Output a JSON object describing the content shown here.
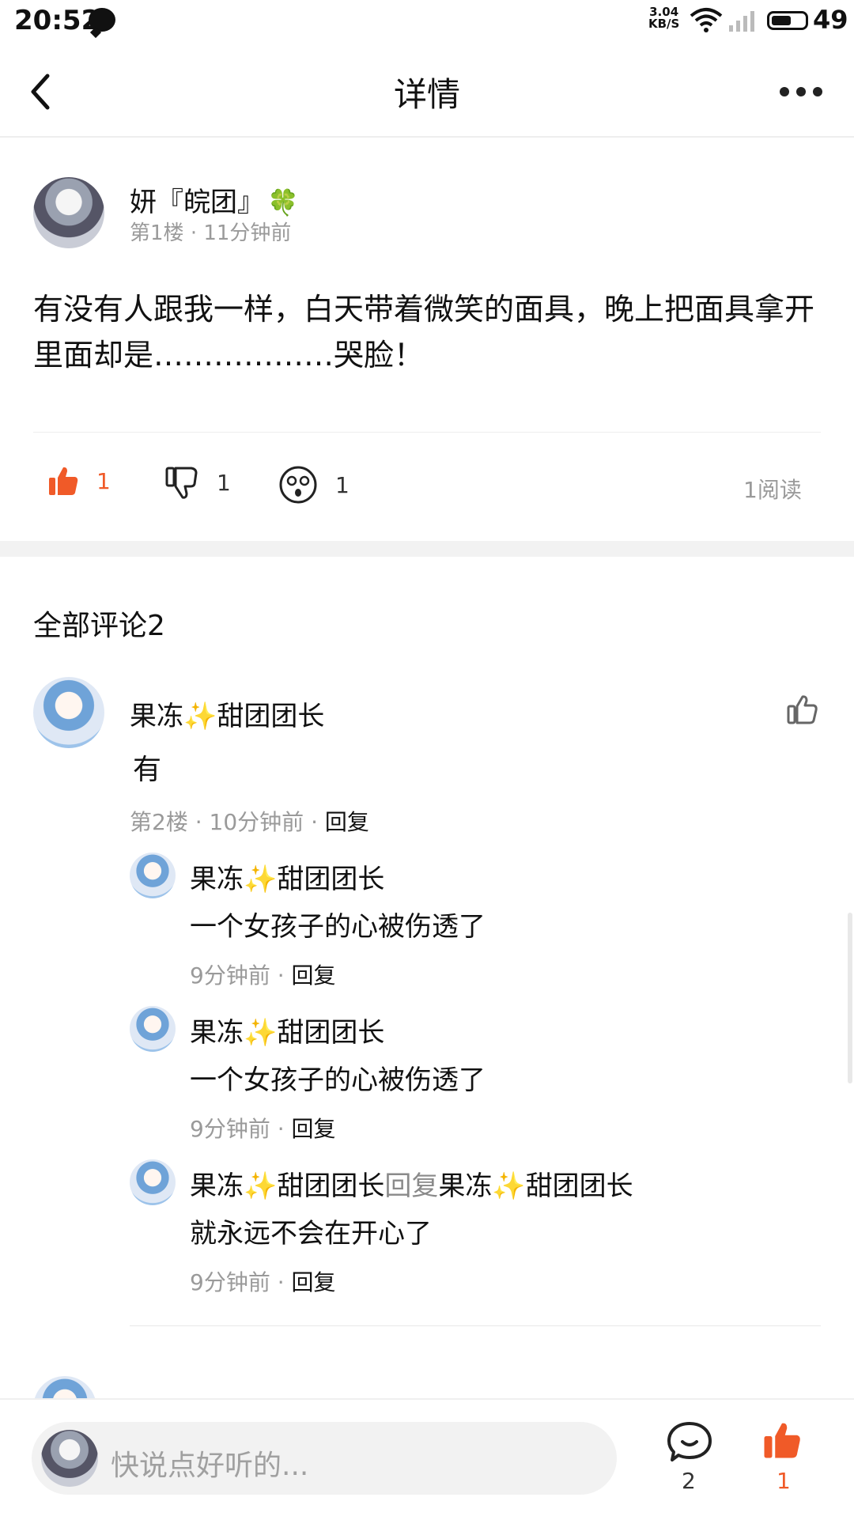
{
  "status_bar": {
    "time": "20:52",
    "net_speed": "3.04",
    "net_unit": "KB/S",
    "battery": "49"
  },
  "header": {
    "title": "详情"
  },
  "post": {
    "user": "妍『皖团』",
    "user_emoji": "🍀",
    "floor": "第1楼",
    "time": "11分钟前",
    "text": "有没有人跟我一样，白天带着微笑的面具，晚上把面具拿开里面却是………………哭脸！",
    "like_count": "1",
    "dislike_count": "1",
    "wow_count": "1",
    "reads": "1阅读"
  },
  "comments_section": {
    "title": "全部评论2"
  },
  "comment1": {
    "user_a": "果冻",
    "sparkle": "✨",
    "user_b": "甜团团长",
    "text": "有",
    "floor": "第2楼",
    "time": "10分钟前",
    "reply": "回复"
  },
  "replies": [
    {
      "user_a": "果冻",
      "user_b": "甜团团长",
      "text": "一个女孩子的心被伤透了",
      "time": "9分钟前",
      "reply": "回复"
    },
    {
      "user_a": "果冻",
      "user_b": "甜团团长",
      "text": "一个女孩子的心被伤透了",
      "time": "9分钟前",
      "reply": "回复"
    },
    {
      "user_a": "果冻",
      "user_b": "甜团团长",
      "reply_word": "回复",
      "target_a": "果冻",
      "target_b": "甜团团长",
      "text": "就永远不会在开心了",
      "time": "9分钟前",
      "reply": "回复"
    }
  ],
  "bottom_bar": {
    "placeholder": "快说点好听的...",
    "comment_count": "2",
    "like_count": "1"
  },
  "colors": {
    "accent": "#f05a28",
    "gray_text": "#9a9a9a"
  }
}
